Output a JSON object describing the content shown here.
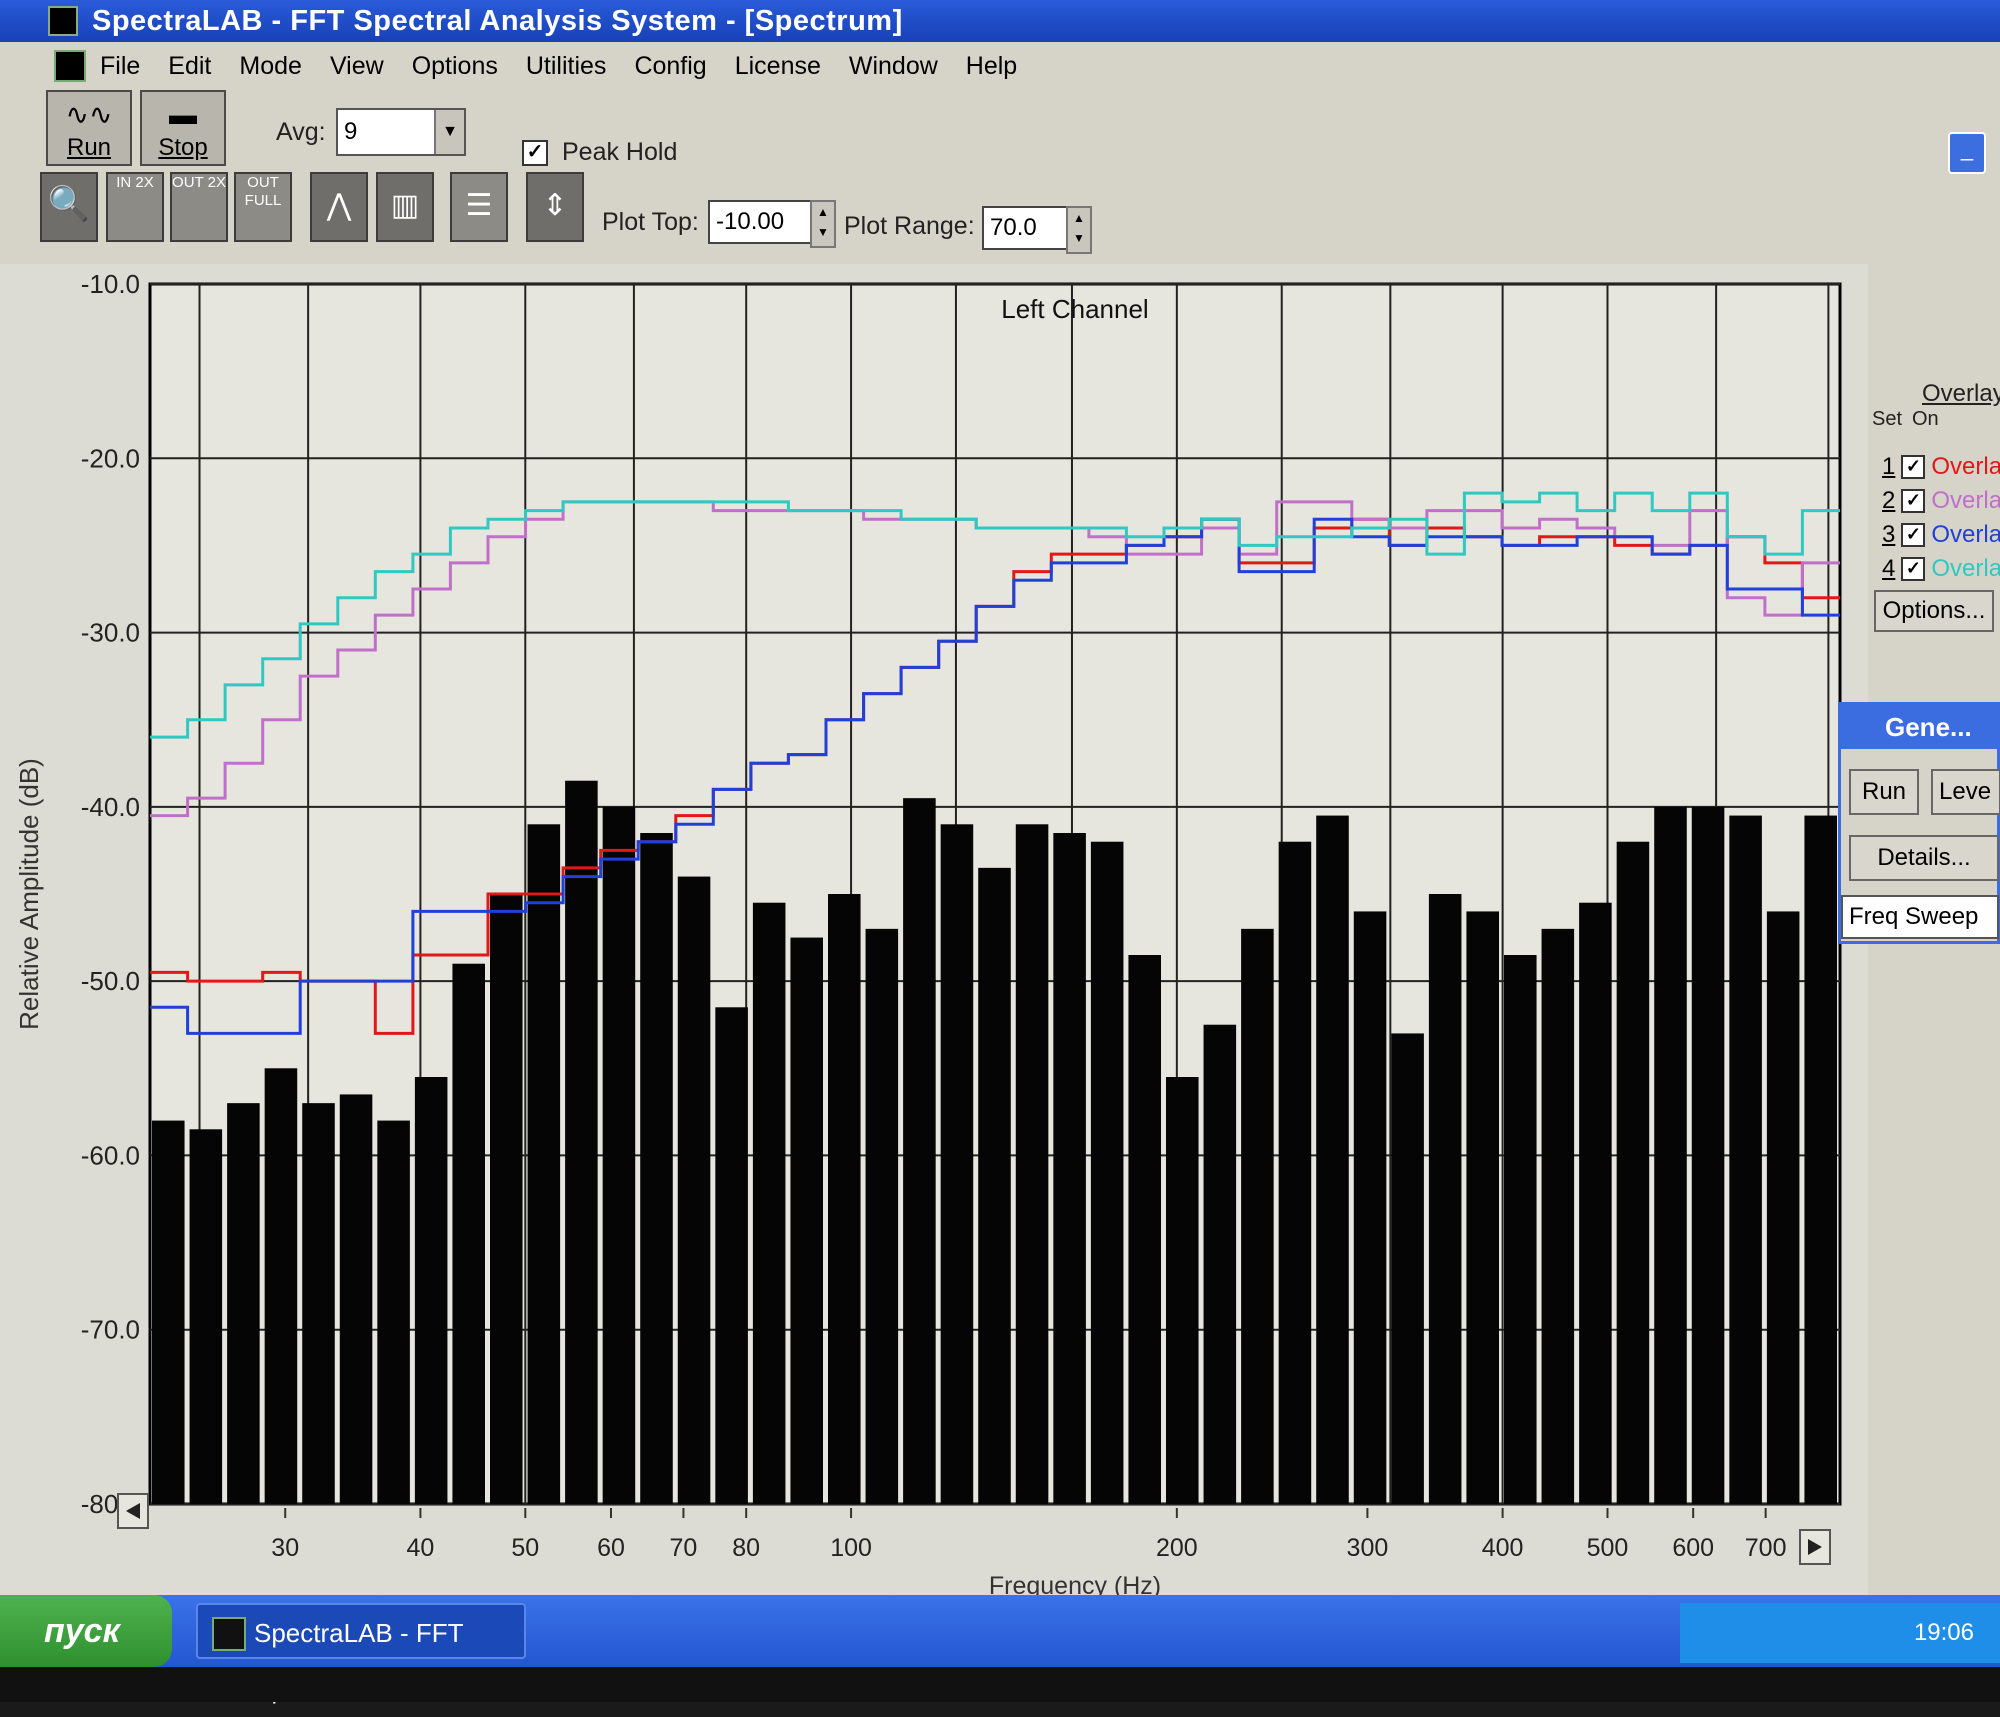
{
  "window": {
    "title": "SpectraLAB - FFT Spectral Analysis System - [Spectrum]"
  },
  "menu": [
    "File",
    "Edit",
    "Mode",
    "View",
    "Options",
    "Utilities",
    "Config",
    "License",
    "Window",
    "Help"
  ],
  "toolbar": {
    "run_label": "Run",
    "stop_label": "Stop",
    "avg_label": "Avg:",
    "avg_value": "9",
    "peak_hold_label": "Peak Hold",
    "peak_hold_checked": true,
    "zoom_in_label": "IN 2X",
    "zoom_out_label": "OUT 2X",
    "zoom_full_label": "OUT FULL",
    "plot_top_label": "Plot Top:",
    "plot_top_value": "-10.00",
    "plot_range_label": "Plot Range:",
    "plot_range_value": "70.0"
  },
  "overlay_panel": {
    "header": "Overlay",
    "col_set": "Set",
    "col_on": "On",
    "items": [
      {
        "num": "1",
        "label": "Overla",
        "color": "#e01818"
      },
      {
        "num": "2",
        "label": "Overla",
        "color": "#c070c8"
      },
      {
        "num": "3",
        "label": "Overla",
        "color": "#2040d8"
      },
      {
        "num": "4",
        "label": "Overla",
        "color": "#30c8c0"
      }
    ],
    "options_label": "Options..."
  },
  "generator_panel": {
    "title": "Gene...",
    "run_label": "Run",
    "level_label": "Leve",
    "details_label": "Details...",
    "mode_value": "Freq Sweep"
  },
  "taskbar": {
    "start_label": "пуск",
    "task_label": "SpectraLAB - FFT Spe...",
    "clock": "19:06"
  },
  "chart_data": {
    "type": "bar",
    "title": "Left Channel",
    "xlabel": "Frequency (Hz)",
    "ylabel": "Relative Amplitude (dB)",
    "x_scale": "log",
    "xlim": [
      22.5,
      820
    ],
    "ylim": [
      -80.0,
      -10.0
    ],
    "yticks": [
      "-10.0",
      "-20.0",
      "-30.0",
      "-40.0",
      "-50.0",
      "-60.0",
      "-70.0",
      "-80.0"
    ],
    "xtick_labels": [
      "30",
      "40",
      "50",
      "60",
      "70",
      "80",
      "100",
      "200",
      "300",
      "400",
      "500",
      "600",
      "700"
    ],
    "xtick_values": [
      30,
      40,
      50,
      60,
      70,
      80,
      100,
      200,
      300,
      400,
      500,
      600,
      700
    ],
    "grid_lines_hz": [
      25,
      31.5,
      40,
      50,
      63,
      80,
      100,
      125,
      160,
      200,
      250,
      315,
      400,
      500,
      630,
      800
    ],
    "grid": true,
    "bars_db": [
      -58,
      -58.5,
      -57,
      -55,
      -57,
      -56.5,
      -58,
      -55.5,
      -49,
      -45,
      -41,
      -38.5,
      -40,
      -41.5,
      -44,
      -51.5,
      -45.5,
      -47.5,
      -45,
      -47,
      -39.5,
      -41,
      -43.5,
      -41,
      -41.5,
      -42,
      -48.5,
      -55.5,
      -52.5,
      -47,
      -42,
      -40.5,
      -46,
      -53,
      -45,
      -46,
      -48.5,
      -47,
      -45.5,
      -42,
      -40,
      -40,
      -40.5,
      -46,
      -40.5
    ],
    "series": [
      {
        "name": "Overlay 1",
        "color": "#e01818",
        "values": [
          -49.5,
          -50,
          -50,
          -49.5,
          -50,
          -50,
          -53,
          -48.5,
          -48.5,
          -45,
          -45,
          -43.5,
          -42.5,
          -42,
          -40.5,
          -39,
          -37.5,
          -37,
          -35,
          -33.5,
          -32,
          -30.5,
          -28.5,
          -26.5,
          -25.5,
          -25.5,
          -25,
          -24.5,
          -23.5,
          -26,
          -26,
          -24,
          -23.5,
          -25,
          -24,
          -24.5,
          -25,
          -24.5,
          -24.5,
          -25,
          -25.5,
          -25,
          -24.5,
          -26,
          -28
        ]
      },
      {
        "name": "Overlay 2",
        "color": "#c070c8",
        "values": [
          -40.5,
          -39.5,
          -37.5,
          -35,
          -32.5,
          -31,
          -29,
          -27.5,
          -26,
          -24.5,
          -23.5,
          -22.5,
          -22.5,
          -22.5,
          -22.5,
          -23,
          -23,
          -23,
          -23,
          -23.5,
          -23.5,
          -23.5,
          -24,
          -24,
          -24,
          -24.5,
          -25.5,
          -25.5,
          -24,
          -25.5,
          -22.5,
          -22.5,
          -23.5,
          -24,
          -23,
          -23,
          -24,
          -23.5,
          -24,
          -24.5,
          -25,
          -23,
          -28,
          -29,
          -26
        ]
      },
      {
        "name": "Overlay 3",
        "color": "#2040d8",
        "values": [
          -51.5,
          -53,
          -53,
          -53,
          -50,
          -50,
          -50,
          -46,
          -46,
          -46,
          -45.5,
          -44,
          -43,
          -42,
          -41,
          -39,
          -37.5,
          -37,
          -35,
          -33.5,
          -32,
          -30.5,
          -28.5,
          -27,
          -26,
          -26,
          -25,
          -24.5,
          -23.5,
          -26.5,
          -26.5,
          -23.5,
          -24.5,
          -25,
          -24.5,
          -24.5,
          -25,
          -25,
          -24.5,
          -24.5,
          -25.5,
          -25,
          -27.5,
          -27.5,
          -29
        ]
      },
      {
        "name": "Overlay 4",
        "color": "#30c8c0",
        "values": [
          -36,
          -35,
          -33,
          -31.5,
          -29.5,
          -28,
          -26.5,
          -25.5,
          -24,
          -23.5,
          -23,
          -22.5,
          -22.5,
          -22.5,
          -22.5,
          -22.5,
          -22.5,
          -23,
          -23,
          -23,
          -23.5,
          -23.5,
          -24,
          -24,
          -24,
          -24,
          -24.5,
          -24,
          -23.5,
          -25,
          -24.5,
          -24.5,
          -24,
          -23.5,
          -25.5,
          -22,
          -22.5,
          -22,
          -23,
          -22,
          -23,
          -22,
          -24.5,
          -25.5,
          -23
        ]
      }
    ]
  }
}
